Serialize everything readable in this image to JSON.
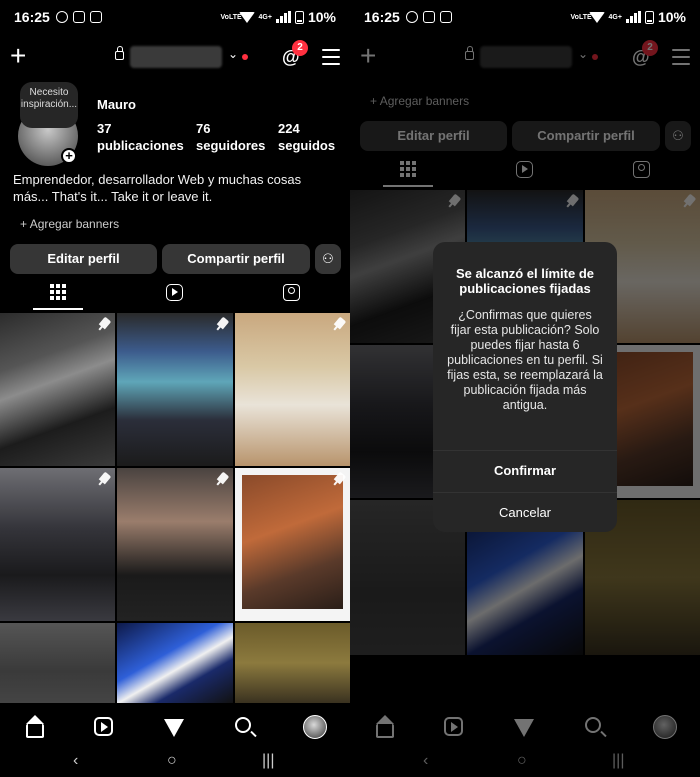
{
  "status": {
    "time": "16:25",
    "battery": "10%",
    "network": "4G+",
    "volte": "VoLTE"
  },
  "header": {
    "threads_badge": "2"
  },
  "profile": {
    "note": "Necesito inspiración...",
    "name": "Mauro",
    "stats": [
      {
        "value": "37",
        "label": "publicaciones"
      },
      {
        "value": "76",
        "label": "seguidores"
      },
      {
        "value": "224",
        "label": "seguidos"
      }
    ],
    "bio_line1": "Emprendedor, desarrollador Web y muchas cosas",
    "bio_line2": "más... That's it... Take it or leave it.",
    "banners": "Agregar banners"
  },
  "buttons": {
    "edit": "Editar perfil",
    "share": "Compartir perfil"
  },
  "dialog": {
    "title": "Se alcanzó el límite de publicaciones fijadas",
    "body": "¿Confirmas que quieres fijar esta publicación? Solo puedes fijar hasta 6 publicaciones en tu perfil. Si fijas esta, se reemplazará la publicación fijada más antigua.",
    "confirm": "Confirmar",
    "cancel": "Cancelar"
  },
  "icons": {
    "nav": [
      "home-icon",
      "reels-icon",
      "direct-send-icon",
      "search-icon",
      "profile-avatar-icon"
    ],
    "tabs": [
      "grid-icon",
      "reels-tab-icon",
      "tagged-icon"
    ]
  },
  "colors": {
    "accent": "#ff3040",
    "button_bg": "#363636",
    "dialog_bg": "#262626"
  }
}
